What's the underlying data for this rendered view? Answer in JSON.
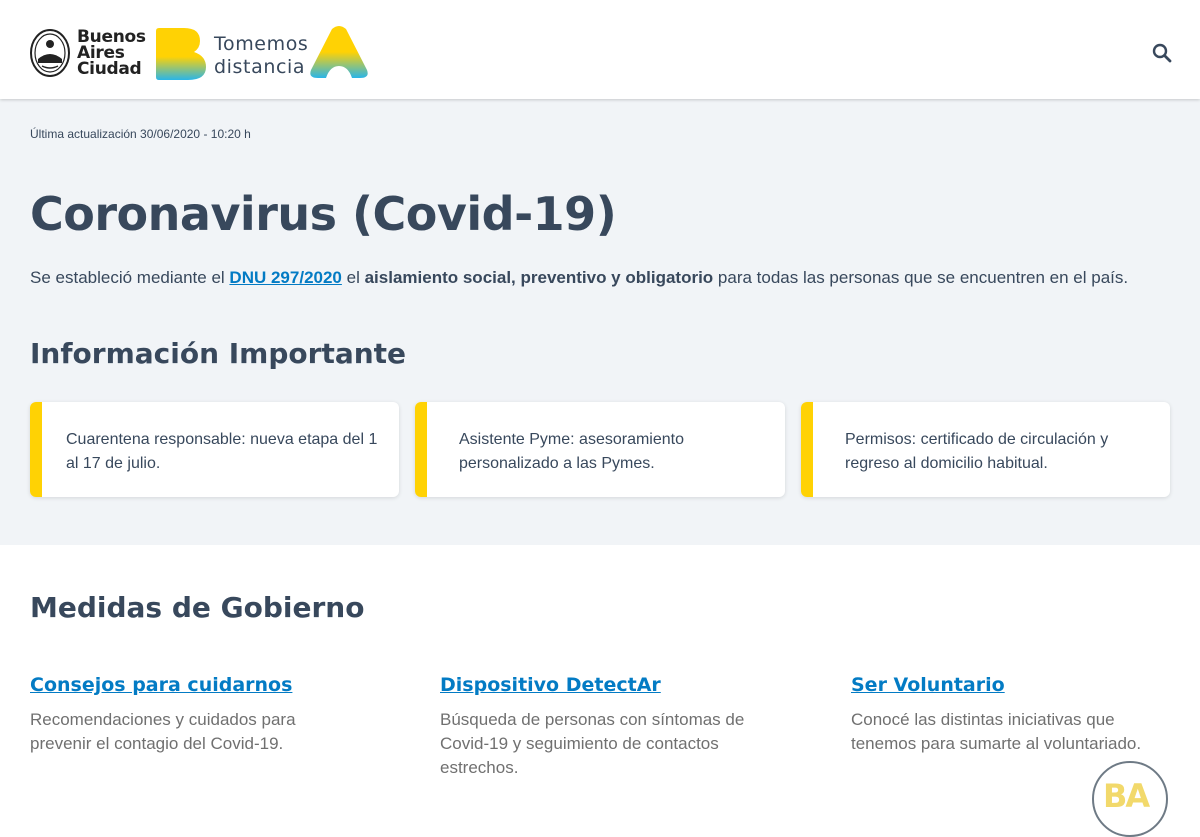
{
  "header": {
    "city_logo_lines": [
      "Buenos",
      "Aires",
      "Ciudad"
    ],
    "campaign_lines": [
      "Tomemos",
      "distancia"
    ],
    "search_icon": "search-icon"
  },
  "hero": {
    "updated": "Última actualización 30/06/2020 - 10:20 h",
    "title": "Coronavirus (Covid-19)",
    "intro_before": "Se estableció mediante el",
    "intro_link": "DNU 297/2020",
    "intro_mid": "el",
    "intro_bold": "aislamiento social, preventivo y obligatorio",
    "intro_after": "para todas las personas que se encuentren en el país.",
    "info_heading": "Información Importante",
    "cards": [
      {
        "text": "Cuarentena responsable: nueva etapa del 1 al 17 de julio."
      },
      {
        "text": "Asistente Pyme: asesoramiento personalizado a las Pymes."
      },
      {
        "text": "Permisos: certificado de circulación y regreso al domicilio habitual."
      }
    ]
  },
  "measures": {
    "heading": "Medidas de Gobierno",
    "items": [
      {
        "title": "Consejos para cuidarnos",
        "desc": "Recomendaciones y cuidados para prevenir el contagio del Covid-19."
      },
      {
        "title": "Dispositivo DetectAr",
        "desc": "Búsqueda de personas con síntomas de Covid-19 y seguimiento de contactos estrechos."
      },
      {
        "title": "Ser Voluntario",
        "desc": "Conocé las distintas iniciativas que tenemos para sumarte al voluntariado."
      }
    ]
  },
  "chat": {
    "label": "BA"
  },
  "colors": {
    "accent_blue": "#037bc4",
    "accent_yellow": "#ffd204",
    "text_dark": "#38485c",
    "hero_bg": "#f1f4f7"
  }
}
